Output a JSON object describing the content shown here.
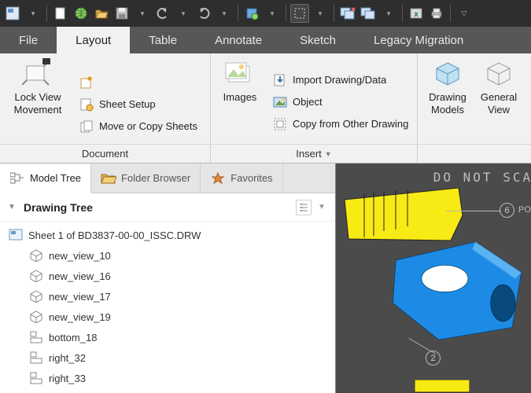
{
  "tabs": {
    "file": "File",
    "layout": "Layout",
    "table": "Table",
    "annotate": "Annotate",
    "sketch": "Sketch",
    "legacy": "Legacy Migration"
  },
  "ribbon": {
    "lock_view": "Lock View\nMovement",
    "sheet_setup": "Sheet Setup",
    "move_copy": "Move or Copy Sheets",
    "doc_panel": "Document",
    "images": "Images",
    "import_drawing": "Import Drawing/Data",
    "object": "Object",
    "copy_from": "Copy from Other Drawing",
    "insert_panel": "Insert",
    "drawing_models": "Drawing\nModels",
    "general_view": "General\nView"
  },
  "side_tabs": {
    "model_tree": "Model Tree",
    "folder_browser": "Folder Browser",
    "favorites": "Favorites"
  },
  "tree": {
    "title": "Drawing Tree",
    "root": "Sheet 1 of BD3837-00-00_ISSC.DRW",
    "items": [
      {
        "label": "new_view_10",
        "kind": "iso"
      },
      {
        "label": "new_view_16",
        "kind": "iso"
      },
      {
        "label": "new_view_17",
        "kind": "iso"
      },
      {
        "label": "new_view_19",
        "kind": "iso"
      },
      {
        "label": "bottom_18",
        "kind": "flat"
      },
      {
        "label": "right_32",
        "kind": "flat"
      },
      {
        "label": "right_33",
        "kind": "flat"
      }
    ]
  },
  "canvas": {
    "watermark": "DO NOT SCALE.",
    "balloons": [
      "6",
      "2"
    ],
    "pos_label": "POS"
  }
}
